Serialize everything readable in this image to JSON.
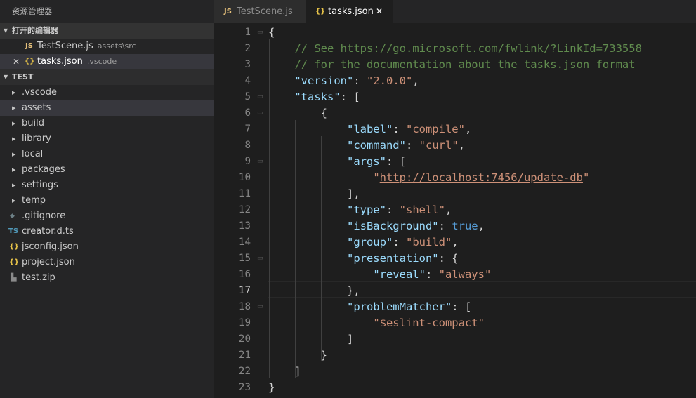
{
  "sidebar": {
    "title": "资源管理器",
    "open_editors": {
      "header": "打开的编辑器",
      "items": [
        {
          "icon": "JS",
          "name": "TestScene.js",
          "desc": "assets\\src"
        },
        {
          "icon": "{}",
          "close": "✕",
          "name": "tasks.json",
          "desc": ".vscode"
        }
      ]
    },
    "project": {
      "header": "TEST",
      "folders": [
        ".vscode",
        "assets",
        "build",
        "library",
        "local",
        "packages",
        "settings",
        "temp"
      ],
      "files": [
        {
          "icon": "◆",
          "name": ".gitignore"
        },
        {
          "icon": "TS",
          "name": "creator.d.ts"
        },
        {
          "icon": "{}",
          "name": "jsconfig.json"
        },
        {
          "icon": "{}",
          "name": "project.json"
        },
        {
          "icon": "▙",
          "name": "test.zip"
        }
      ]
    }
  },
  "tabs": [
    {
      "icon": "JS",
      "label": "TestScene.js"
    },
    {
      "icon": "{}",
      "label": "tasks.json",
      "close": "✕"
    }
  ],
  "editor": {
    "current_line": 17,
    "lines": [
      [
        [
          "p",
          "{"
        ]
      ],
      [
        [
          "p",
          "    "
        ],
        [
          "c",
          "// See "
        ],
        [
          "cu",
          "https://go.microsoft.com/fwlink/?LinkId=733558"
        ]
      ],
      [
        [
          "p",
          "    "
        ],
        [
          "c",
          "// for the documentation about the tasks.json format"
        ]
      ],
      [
        [
          "p",
          "    "
        ],
        [
          "k",
          "\"version\""
        ],
        [
          "p",
          ": "
        ],
        [
          "s",
          "\"2.0.0\""
        ],
        [
          "p",
          ","
        ]
      ],
      [
        [
          "p",
          "    "
        ],
        [
          "k",
          "\"tasks\""
        ],
        [
          "p",
          ": ["
        ]
      ],
      [
        [
          "p",
          "        {"
        ]
      ],
      [
        [
          "p",
          "            "
        ],
        [
          "k",
          "\"label\""
        ],
        [
          "p",
          ": "
        ],
        [
          "s",
          "\"compile\""
        ],
        [
          "p",
          ","
        ]
      ],
      [
        [
          "p",
          "            "
        ],
        [
          "k",
          "\"command\""
        ],
        [
          "p",
          ": "
        ],
        [
          "s",
          "\"curl\""
        ],
        [
          "p",
          ","
        ]
      ],
      [
        [
          "p",
          "            "
        ],
        [
          "k",
          "\"args\""
        ],
        [
          "p",
          ": ["
        ]
      ],
      [
        [
          "p",
          "                "
        ],
        [
          "s",
          "\""
        ],
        [
          "su",
          "http://localhost:7456/update-db"
        ],
        [
          "s",
          "\""
        ]
      ],
      [
        [
          "p",
          "            ],"
        ]
      ],
      [
        [
          "p",
          "            "
        ],
        [
          "k",
          "\"type\""
        ],
        [
          "p",
          ": "
        ],
        [
          "s",
          "\"shell\""
        ],
        [
          "p",
          ","
        ]
      ],
      [
        [
          "p",
          "            "
        ],
        [
          "k",
          "\"isBackground\""
        ],
        [
          "p",
          ": "
        ],
        [
          "b",
          "true"
        ],
        [
          "p",
          ","
        ]
      ],
      [
        [
          "p",
          "            "
        ],
        [
          "k",
          "\"group\""
        ],
        [
          "p",
          ": "
        ],
        [
          "s",
          "\"build\""
        ],
        [
          "p",
          ","
        ]
      ],
      [
        [
          "p",
          "            "
        ],
        [
          "k",
          "\"presentation\""
        ],
        [
          "p",
          ": {"
        ]
      ],
      [
        [
          "p",
          "                "
        ],
        [
          "k",
          "\"reveal\""
        ],
        [
          "p",
          ": "
        ],
        [
          "s",
          "\"always\""
        ]
      ],
      [
        [
          "p",
          "            },"
        ]
      ],
      [
        [
          "p",
          "            "
        ],
        [
          "k",
          "\"problemMatcher\""
        ],
        [
          "p",
          ": ["
        ]
      ],
      [
        [
          "p",
          "                "
        ],
        [
          "s",
          "\"$eslint-compact\""
        ]
      ],
      [
        [
          "p",
          "            ]"
        ]
      ],
      [
        [
          "p",
          "        }"
        ]
      ],
      [
        [
          "p",
          "    ]"
        ]
      ],
      [
        [
          "p",
          "}"
        ]
      ]
    ]
  },
  "colors": {
    "background": "#1e1e1e",
    "sidebar": "#252526",
    "key": "#9cdcfe",
    "string": "#ce9178",
    "comment": "#608b4e",
    "keyword": "#569cd6",
    "js_icon": "#e5c07b",
    "ts_icon": "#519aba",
    "json_icon": "#e8c449"
  }
}
